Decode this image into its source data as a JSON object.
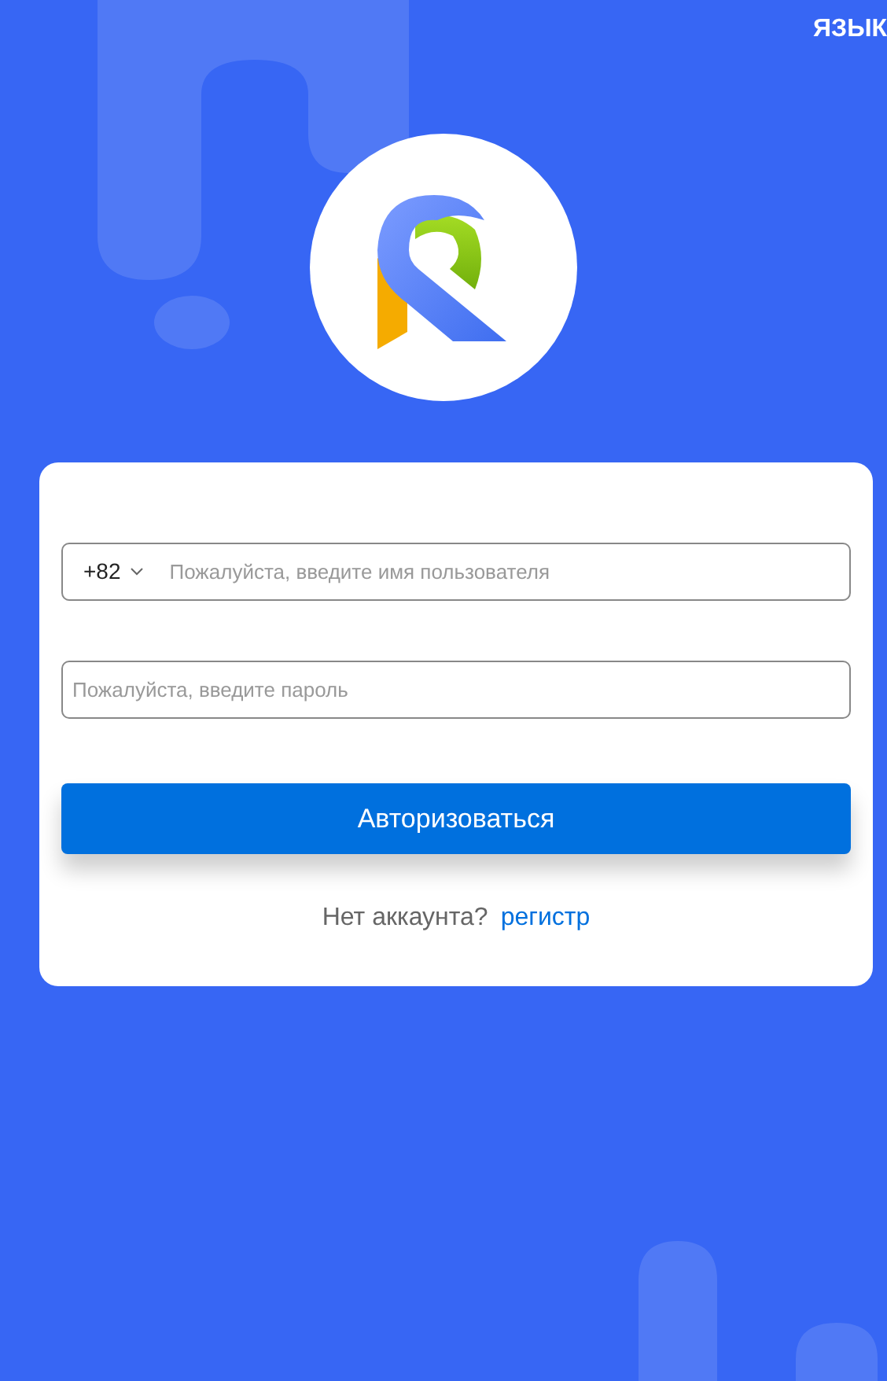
{
  "language_button": "ЯЗЫК",
  "login_form": {
    "country_code": "+82",
    "username_placeholder": "Пожалуйста, введите имя пользователя",
    "password_placeholder": "Пожалуйста, введите пароль",
    "submit": "Авторизоваться",
    "no_account_text": "Нет аккаунта?",
    "register_link": "регистр"
  }
}
